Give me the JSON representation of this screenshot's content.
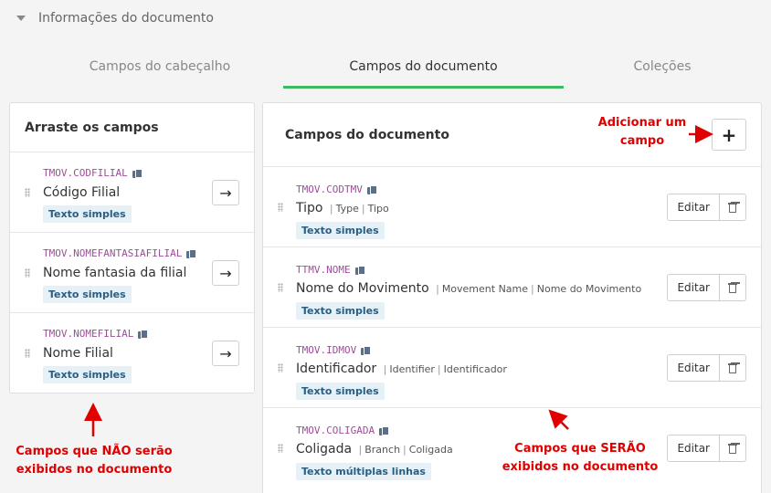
{
  "section": {
    "title": "Informações do documento"
  },
  "tabs": [
    {
      "label": "Campos do cabeçalho"
    },
    {
      "label": "Campos do documento"
    },
    {
      "label": "Coleções"
    }
  ],
  "left_panel": {
    "title": "Arraste os campos",
    "items": [
      {
        "code": "TMOV.CODFILIAL",
        "label": "Código Filial",
        "badge": "Texto simples"
      },
      {
        "code": "TMOV.NOMEFANTASIAFILIAL",
        "label": "Nome fantasia da filial",
        "badge": "Texto simples"
      },
      {
        "code": "TMOV.NOMEFILIAL",
        "label": "Nome Filial",
        "badge": "Texto simples"
      }
    ]
  },
  "right_panel": {
    "title": "Campos do documento",
    "add_label": "+",
    "edit_label": "Editar",
    "items": [
      {
        "code": "TMOV.CODTMV",
        "label": "Tipo",
        "alias1": "Type",
        "alias2": "Tipo",
        "badge": "Texto simples"
      },
      {
        "code": "TTMV.NOME",
        "label": "Nome do Movimento",
        "alias1": "Movement Name",
        "alias2": "Nome do Movimento",
        "badge": "Texto simples"
      },
      {
        "code": "TMOV.IDMOV",
        "label": "Identificador",
        "alias1": "Identifier",
        "alias2": "Identificador",
        "badge": "Texto simples"
      },
      {
        "code": "TMOV.COLIGADA",
        "label": "Coligada",
        "alias1": "Branch",
        "alias2": "Coligada",
        "badge": "Texto múltiplas linhas"
      }
    ]
  },
  "annotations": {
    "add_line1": "Adicionar um",
    "add_line2": "campo",
    "left_line1": "Campos que NÃO serão",
    "left_line2": "exibidos no documento",
    "right_line1": "Campos que SERÃO",
    "right_line2": "exibidos no documento",
    "color": "#e00000"
  }
}
